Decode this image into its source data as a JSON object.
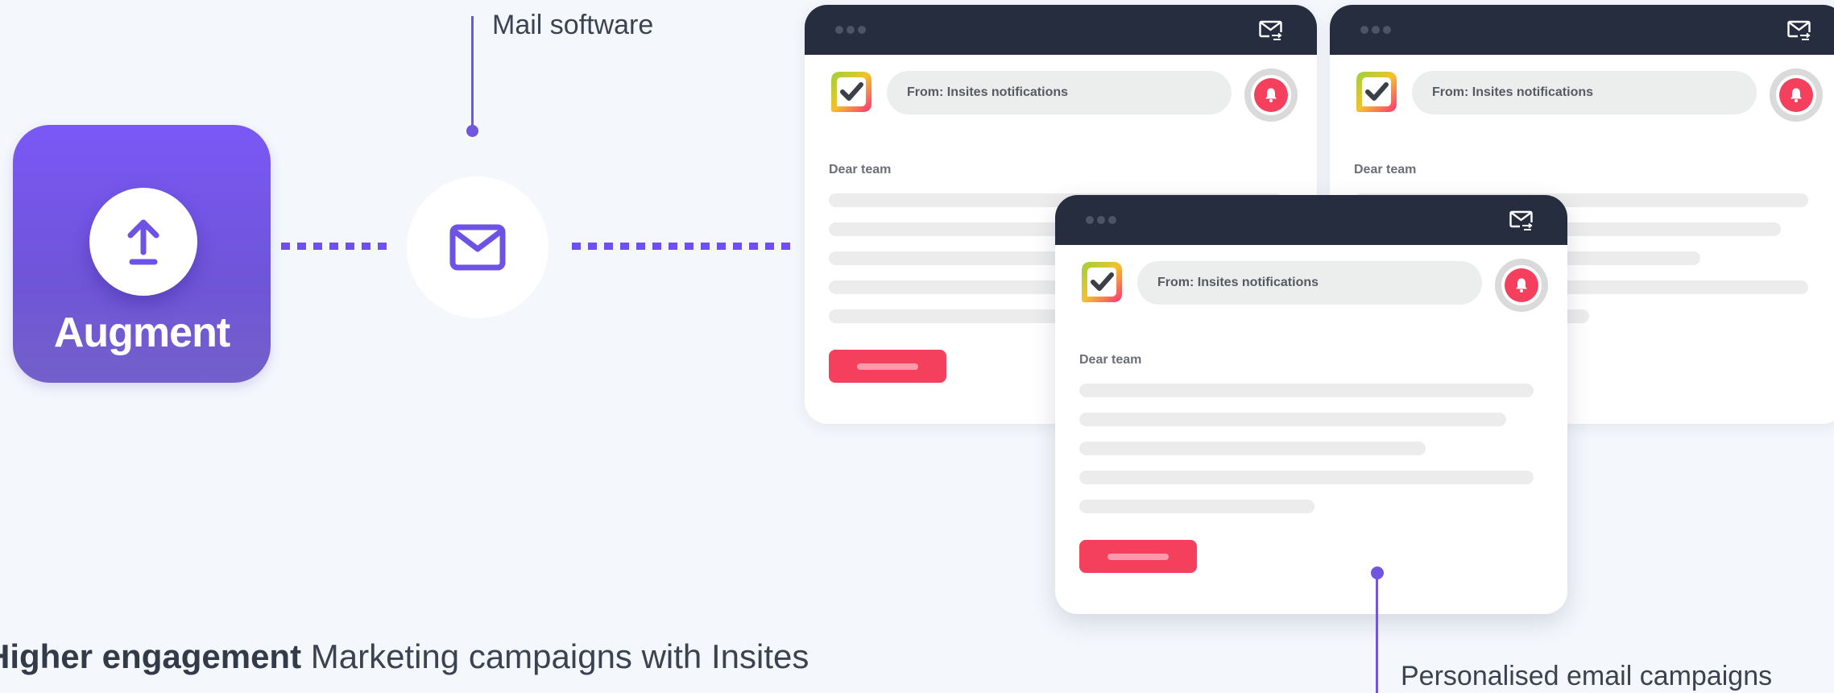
{
  "augment": {
    "title": "Augment",
    "icon": "upload-icon",
    "color": "#7a58f6"
  },
  "mail_software": {
    "label": "Mail software",
    "icon": "envelope-icon"
  },
  "email_cards": [
    {
      "from": "From: Insites notifications",
      "greeting": "Dear team"
    },
    {
      "from": "From: Insites notifications",
      "greeting": "Dear team"
    },
    {
      "from": "From: Insites notifications",
      "greeting": "Dear team"
    }
  ],
  "personalised": {
    "label": "Personalised email campaigns"
  },
  "tagline": {
    "bold": "Higher engagement",
    "rest": " Marketing campaigns with Insites"
  },
  "colors": {
    "accent": "#6f55e0",
    "brand_red": "#f5405d",
    "dark_bar": "#262d3e"
  }
}
